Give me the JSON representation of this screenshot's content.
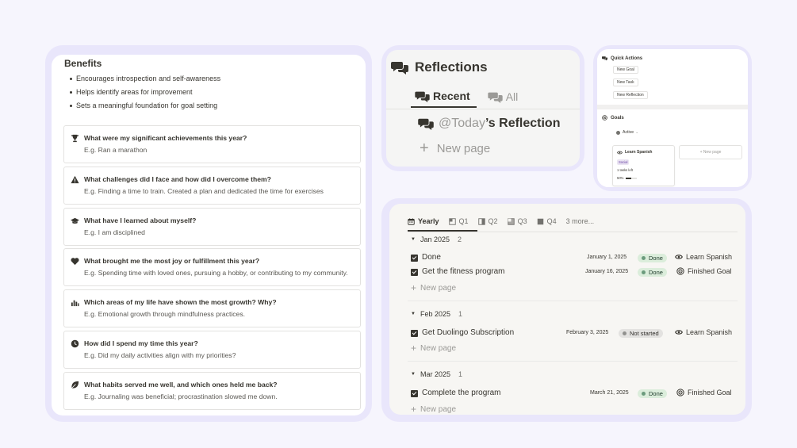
{
  "benefits": {
    "title": "Benefits",
    "items": [
      "Encourages introspection and self-awareness",
      "Helps identify areas for improvement",
      "Sets a meaningful foundation for goal setting"
    ]
  },
  "questions": [
    {
      "icon": "trophy-icon",
      "title": "What were my significant achievements this year?",
      "hint": "E.g. Ran a marathon"
    },
    {
      "icon": "warning-triangle-icon",
      "title": "What challenges did I face and how did I overcome them?",
      "hint": "E.g. Finding a time to train. Created a plan and dedicated the time for exercises"
    },
    {
      "icon": "graduation-cap-icon",
      "title": "What have I learned about myself?",
      "hint": "E.g. I am disciplined"
    },
    {
      "icon": "heart-icon",
      "title": "What brought me the most joy or fulfillment this year?",
      "hint": "E.g. Spending time with loved ones, pursuing a hobby, or contributing to my community."
    },
    {
      "icon": "bar-chart-icon",
      "title": "Which areas of my life have shown the most growth? Why?",
      "hint": "E.g. Emotional growth through mindfulness practices."
    },
    {
      "icon": "clock-icon",
      "title": "How did I spend my time this year?",
      "hint": "E.g. Did my daily activities align with my priorities?"
    },
    {
      "icon": "leaf-icon",
      "title": "What habits served me well, and which ones held me back?",
      "hint": "E.g. Journaling was beneficial; procrastination slowed me down."
    }
  ],
  "reflections": {
    "title": "Reflections",
    "tabs": [
      {
        "label": "Recent",
        "active": true
      },
      {
        "label": "All",
        "active": false
      }
    ],
    "entry_mention": "@Today",
    "entry_suffix": "’s Reflection",
    "new_page": "New page"
  },
  "mini": {
    "quick_actions_title": "Quick Actions",
    "buttons": [
      "New Goal",
      "New Task",
      "New Reflection"
    ],
    "goals_title": "Goals",
    "filter": "Active",
    "card": {
      "title": "Learn Spanish",
      "tag": "Social",
      "tasks_left": "1 tasks left",
      "percent": "50%",
      "progress": 0.5
    },
    "new_page": "+ New page"
  },
  "timeline": {
    "tabs": [
      {
        "label": "Yearly",
        "active": true
      },
      {
        "label": "Q1",
        "active": false
      },
      {
        "label": "Q2",
        "active": false
      },
      {
        "label": "Q3",
        "active": false
      },
      {
        "label": "Q4",
        "active": false
      }
    ],
    "more": "3 more...",
    "new_page": "New page",
    "groups": [
      {
        "label": "Jan 2025",
        "count": "2",
        "rows": [
          {
            "name": "Done",
            "date": "January 1, 2025",
            "status": "Done",
            "status_kind": "done",
            "relation": "Learn Spanish",
            "relation_icon": "eye-icon"
          },
          {
            "name": "Get the fitness program",
            "date": "January 16, 2025",
            "status": "Done",
            "status_kind": "done",
            "relation": "Finished Goal",
            "relation_icon": "target-icon"
          }
        ]
      },
      {
        "label": "Feb 2025",
        "count": "1",
        "rows": [
          {
            "name": "Get Duolingo Subscription",
            "date": "February 3, 2025",
            "status": "Not started",
            "status_kind": "ns",
            "relation": "Learn Spanish",
            "relation_icon": "eye-icon"
          }
        ]
      },
      {
        "label": "Mar 2025",
        "count": "1",
        "rows": [
          {
            "name": "Complete the program",
            "date": "March 21, 2025",
            "status": "Done",
            "status_kind": "done",
            "relation": "Finished Goal",
            "relation_icon": "target-icon"
          }
        ]
      }
    ]
  },
  "colors": {
    "page_bg": "#f6f5fd",
    "frame": "#e9e6fb",
    "done_bg": "#dbeddb",
    "not_started_bg": "#e3e2e0"
  }
}
